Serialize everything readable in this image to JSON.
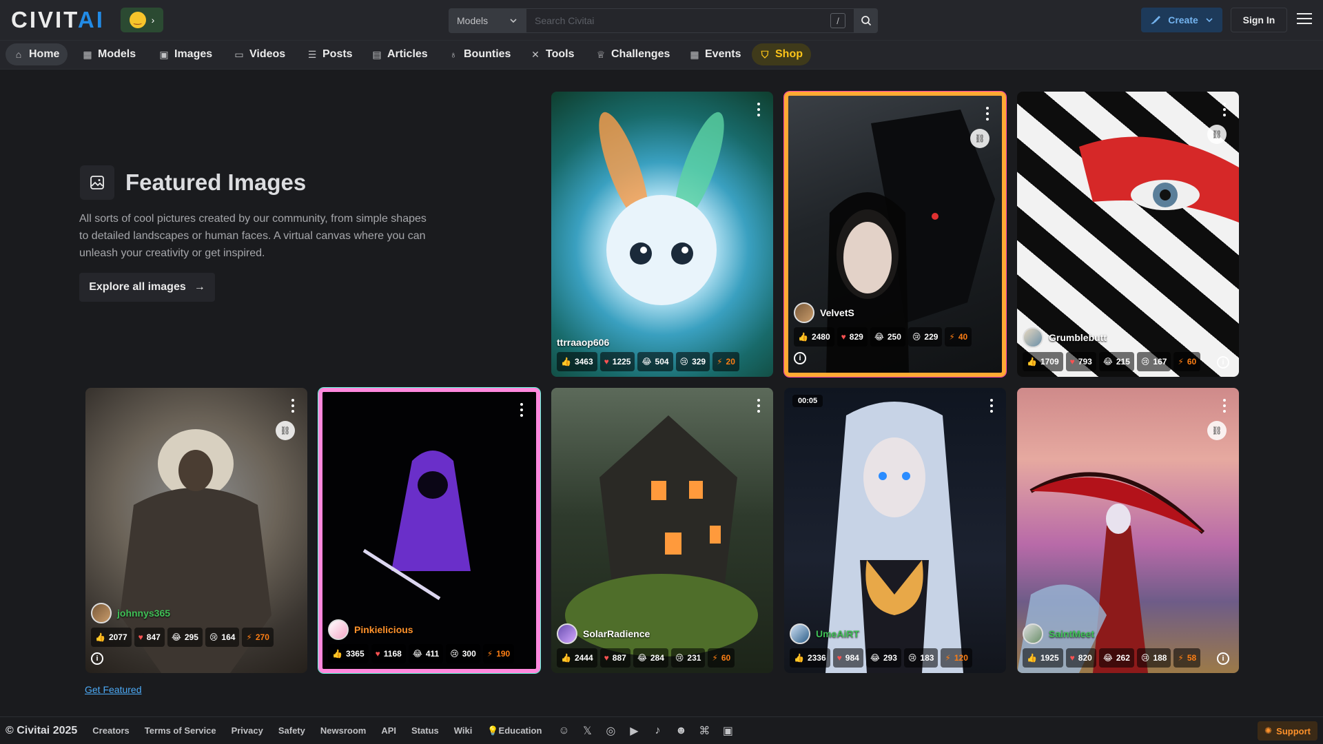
{
  "brand": {
    "logo_main": "CIVIT",
    "logo_accent": "AI",
    "promo_emoji": "😘",
    "promo_arrow": "›"
  },
  "search": {
    "category": "Models",
    "placeholder": "Search Civitai",
    "shortcut": "/"
  },
  "header": {
    "create_label": "Create",
    "signin_label": "Sign In"
  },
  "nav": [
    {
      "label": "Home",
      "icon": "home-icon"
    },
    {
      "label": "Models",
      "icon": "grid-icon"
    },
    {
      "label": "Images",
      "icon": "image-icon"
    },
    {
      "label": "Videos",
      "icon": "video-icon"
    },
    {
      "label": "Posts",
      "icon": "layers-icon"
    },
    {
      "label": "Articles",
      "icon": "document-icon"
    },
    {
      "label": "Bounties",
      "icon": "moneybag-icon"
    },
    {
      "label": "Tools",
      "icon": "tools-icon"
    },
    {
      "label": "Challenges",
      "icon": "trophy-icon"
    },
    {
      "label": "Events",
      "icon": "calendar-icon"
    },
    {
      "label": "Shop",
      "icon": "shopping-bag-icon"
    }
  ],
  "hero": {
    "title": "Featured Images",
    "description": "All sorts of cool pictures created by our community, from simple shapes to detailed landscapes or human faces. A virtual canvas where you can unleash your creativity or get inspired.",
    "explore_label": "Explore all images",
    "get_featured": "Get Featured"
  },
  "cards": [
    {
      "creator": "ttrraaop606",
      "likes": "3463",
      "hearts": "1225",
      "laughs": "504",
      "cries": "329",
      "buzz": "20"
    },
    {
      "creator": "VelvetS",
      "likes": "2480",
      "hearts": "829",
      "laughs": "250",
      "cries": "229",
      "buzz": "40"
    },
    {
      "creator": "Grumblebutt",
      "likes": "1709",
      "hearts": "793",
      "laughs": "215",
      "cries": "167",
      "buzz": "60"
    },
    {
      "creator": "johnnys365",
      "likes": "2077",
      "hearts": "847",
      "laughs": "295",
      "cries": "164",
      "buzz": "270"
    },
    {
      "creator": "Pinkielicious",
      "likes": "3365",
      "hearts": "1168",
      "laughs": "411",
      "cries": "300",
      "buzz": "190"
    },
    {
      "creator": "SolarRadience",
      "likes": "2444",
      "hearts": "887",
      "laughs": "284",
      "cries": "231",
      "buzz": "60"
    },
    {
      "creator": "UmeAiRT",
      "likes": "2336",
      "hearts": "984",
      "laughs": "293",
      "cries": "183",
      "buzz": "120",
      "time": "00:05"
    },
    {
      "creator": "SaintMeet",
      "likes": "1925",
      "hearts": "820",
      "laughs": "262",
      "cries": "188",
      "buzz": "58"
    }
  ],
  "footer": {
    "copyright": "© Civitai 2025",
    "links": [
      "Creators",
      "Terms of Service",
      "Privacy",
      "Safety",
      "Newsroom",
      "API",
      "Status",
      "Wiki",
      "Education"
    ],
    "support": "Support"
  },
  "colors": {
    "accent": "#228be6",
    "buzz": "#fd7e14",
    "shop": "#fcc419",
    "background": "#1a1b1e"
  }
}
